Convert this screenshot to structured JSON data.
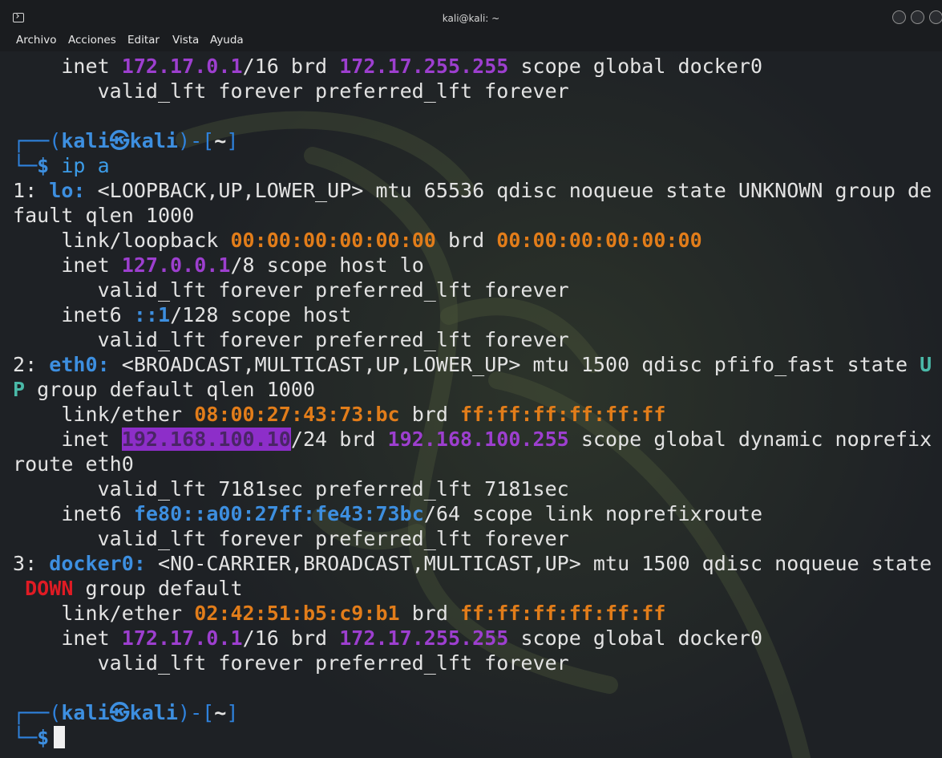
{
  "window": {
    "title": "kali@kali: ~",
    "icon": "terminal-icon"
  },
  "menubar": {
    "items": [
      "Archivo",
      "Acciones",
      "Editar",
      "Vista",
      "Ayuda"
    ]
  },
  "terminal": {
    "top_lines": {
      "l1_a": "    inet ",
      "l1_ip": "172.17.0.1",
      "l1_b": "/16 brd ",
      "l1_brd": "172.17.255.255",
      "l1_c": " scope global docker0",
      "l2": "       valid_lft forever preferred_lft forever"
    },
    "prompt": {
      "open": "┌──(",
      "user": "kali",
      "at": "㉿",
      "host": "kali",
      "mid": ")-[",
      "dir": "~",
      "close": "]",
      "second": "└─",
      "dollar": "$",
      "command": " ip a"
    },
    "iface_lo": {
      "num": "1: ",
      "name": "lo:",
      "flags": " <LOOPBACK,UP,LOWER_UP> mtu 65536 qdisc noqueue state UNKNOWN group de",
      "wrap": "fault qlen 1000",
      "link_a": "    link/loopback ",
      "mac": "00:00:00:00:00:00",
      "link_b": " brd ",
      "mac_brd": "00:00:00:00:00:00",
      "inet_a": "    inet ",
      "ip": "127.0.0.1",
      "inet_b": "/8 scope host lo",
      "valid1": "       valid_lft forever preferred_lft forever",
      "inet6_a": "    inet6 ",
      "ip6": "::1",
      "inet6_b": "/128 scope host",
      "valid2": "       valid_lft forever preferred_lft forever"
    },
    "iface_eth0": {
      "num": "2: ",
      "name": "eth0:",
      "flags": " <BROADCAST,MULTICAST,UP,LOWER_UP> mtu 1500 qdisc pfifo_fast state ",
      "state_1": "U",
      "state_2": "P",
      "wrap": " group default qlen 1000",
      "link_a": "    link/ether ",
      "mac": "08:00:27:43:73:bc",
      "link_b": " brd ",
      "mac_brd": "ff:ff:ff:ff:ff:ff",
      "inet_a": "    inet ",
      "ip": "192.168.100.10",
      "inet_b": "/24 brd ",
      "brd": "192.168.100.255",
      "inet_c": " scope global dynamic noprefix",
      "wrap2": "route eth0",
      "valid1": "       valid_lft 7181sec preferred_lft 7181sec",
      "inet6_a": "    inet6 ",
      "ip6": "fe80::a00:27ff:fe43:73bc",
      "inet6_b": "/64 scope link noprefixroute",
      "valid2": "       valid_lft forever preferred_lft forever"
    },
    "iface_docker0": {
      "num": "3: ",
      "name": "docker0:",
      "flags": " <NO-CARRIER,BROADCAST,MULTICAST,UP> mtu 1500 qdisc noqueue state",
      "pad": " ",
      "state": "DOWN",
      "wrap": " group default",
      "link_a": "    link/ether ",
      "mac": "02:42:51:b5:c9:b1",
      "link_b": " brd ",
      "mac_brd": "ff:ff:ff:ff:ff:ff",
      "inet_a": "    inet ",
      "ip": "172.17.0.1",
      "inet_b": "/16 brd ",
      "brd": "172.17.255.255",
      "inet_c": " scope global docker0",
      "valid1": "       valid_lft forever preferred_lft forever"
    }
  },
  "colors": {
    "prompt_blue": "#3d8fe0",
    "ip_purple": "#9d3fcf",
    "mac_orange": "#e27d1a",
    "state_up": "#4ab9a8",
    "state_down": "#e01b24"
  }
}
